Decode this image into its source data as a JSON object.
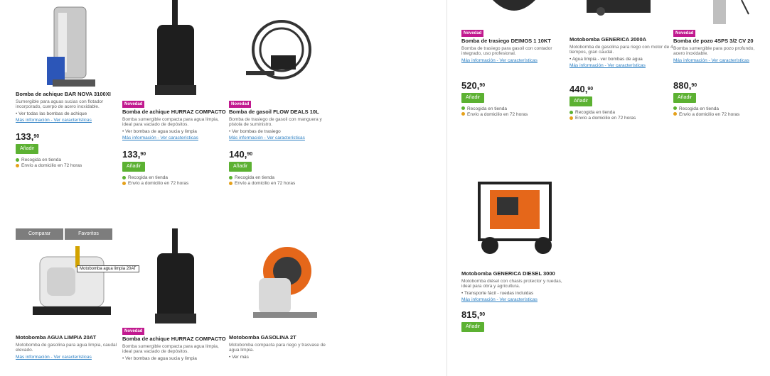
{
  "left": {
    "products": [
      {
        "badge": "",
        "title": "Bomba de achique BAR NOVA 3100XI",
        "desc": "Sumergible para aguas sucias con flotador incorporado, cuerpo de acero inoxidable.",
        "bullet": "• Ver todas las bombas de achique",
        "link": "Más información - Ver características",
        "price": "133",
        "price_sup": "90",
        "btn": "Añadir",
        "stock1": "Recogida en tienda",
        "stock2": "Envío a domicilio en 72 horas"
      },
      {
        "badge": "Novedad",
        "title": "Bomba de achique HURRAZ COMPACTO",
        "desc": "Bomba sumergible compacta para agua limpia, ideal para vaciado de depósitos.",
        "bullet": "• Ver bombas de agua sucia y limpia",
        "link": "Más información - Ver características",
        "price": "133",
        "price_sup": "90",
        "btn": "Añadir",
        "stock1": "Recogida en tienda",
        "stock2": "Envío a domicilio en 72 horas"
      },
      {
        "badge": "Novedad",
        "title": "Bomba de gasoil FLOW DEALS 10L",
        "desc": "Bomba de trasiego de gasoil con manguera y pistola de suministro.",
        "bullet": "• Ver bombas de trasiego",
        "link": "Más información - Ver características",
        "price": "140",
        "price_sup": "90",
        "btn": "Añadir",
        "stock1": "Recogida en tienda",
        "stock2": "Envío a domicilio en 72 horas"
      },
      {
        "badge": "",
        "title": "Motobomba AGUA LIMPIA 20AT",
        "desc": "Motobomba de gasolina para agua limpia, caudal elevado.",
        "bullet": "",
        "link": "Más información - Ver características",
        "price": "",
        "price_sup": "",
        "btn": "",
        "stock1": "",
        "stock2": ""
      },
      {
        "badge": "Novedad",
        "title": "Bomba de achique HURRAZ COMPACTO",
        "desc": "Bomba sumergible compacta para agua limpia, ideal para vaciado de depósitos.",
        "bullet": "• Ver bombas de agua sucia y limpia",
        "link": "",
        "price": "",
        "price_sup": "",
        "btn": "",
        "stock1": "",
        "stock2": ""
      },
      {
        "badge": "",
        "title": "Motobomba GASOLINA 2T",
        "desc": "Motobomba compacta para riego y trasvase de agua limpia.",
        "bullet": "• Ver más",
        "link": "",
        "price": "",
        "price_sup": "",
        "btn": "",
        "stock1": "",
        "stock2": ""
      }
    ],
    "overlay": {
      "compare": "Comparar",
      "fav": "Favoritos"
    },
    "tooltip": "Motobomba agua limpia 20AT"
  },
  "right": {
    "products": [
      {
        "badge": "Novedad",
        "title": "Bomba de trasiego DEIMOS 1 10KT",
        "desc": "Bomba de trasiego para gasoil con contador integrado, uso profesional.",
        "bullet": "",
        "link": "Más información - Ver características",
        "price": "520",
        "price_sup": "90",
        "btn": "Añadir",
        "stock1": "Recogida en tienda",
        "stock2": "Envío a domicilio en 72 horas"
      },
      {
        "badge": "",
        "title": "Motobomba GENERICA 2000A",
        "desc": "Motobomba de gasolina para riego con motor de 4 tiempos, gran caudal.",
        "bullet": "• Agua limpia - ver bombas de agua",
        "link": "Más información - Ver características",
        "price": "440",
        "price_sup": "90",
        "btn": "Añadir",
        "stock1": "Recogida en tienda",
        "stock2": "Envío a domicilio en 72 horas"
      },
      {
        "badge": "Novedad",
        "title": "Bomba de pozo 4SPS 3/2 CV 20",
        "desc": "Bomba sumergible para pozo profundo, acero inoxidable.",
        "bullet": "",
        "link": "Más información - Ver características",
        "price": "880",
        "price_sup": "90",
        "btn": "Añadir",
        "stock1": "Recogida en tienda",
        "stock2": "Envío a domicilio en 72 horas"
      },
      {
        "badge": "",
        "title": "Motobomba GENERICA DIESEL 3000",
        "desc": "Motobomba diésel con chasis protector y ruedas, ideal para obra y agricultura.",
        "bullet": "• Transporte fácil - ruedas incluidas",
        "link": "Más información - Ver características",
        "price": "815",
        "price_sup": "90",
        "btn": "Añadir",
        "stock1": "",
        "stock2": ""
      }
    ]
  },
  "colors": {
    "badge": "#c11a8f",
    "button": "#5cb132",
    "link": "#2a7ec2"
  }
}
